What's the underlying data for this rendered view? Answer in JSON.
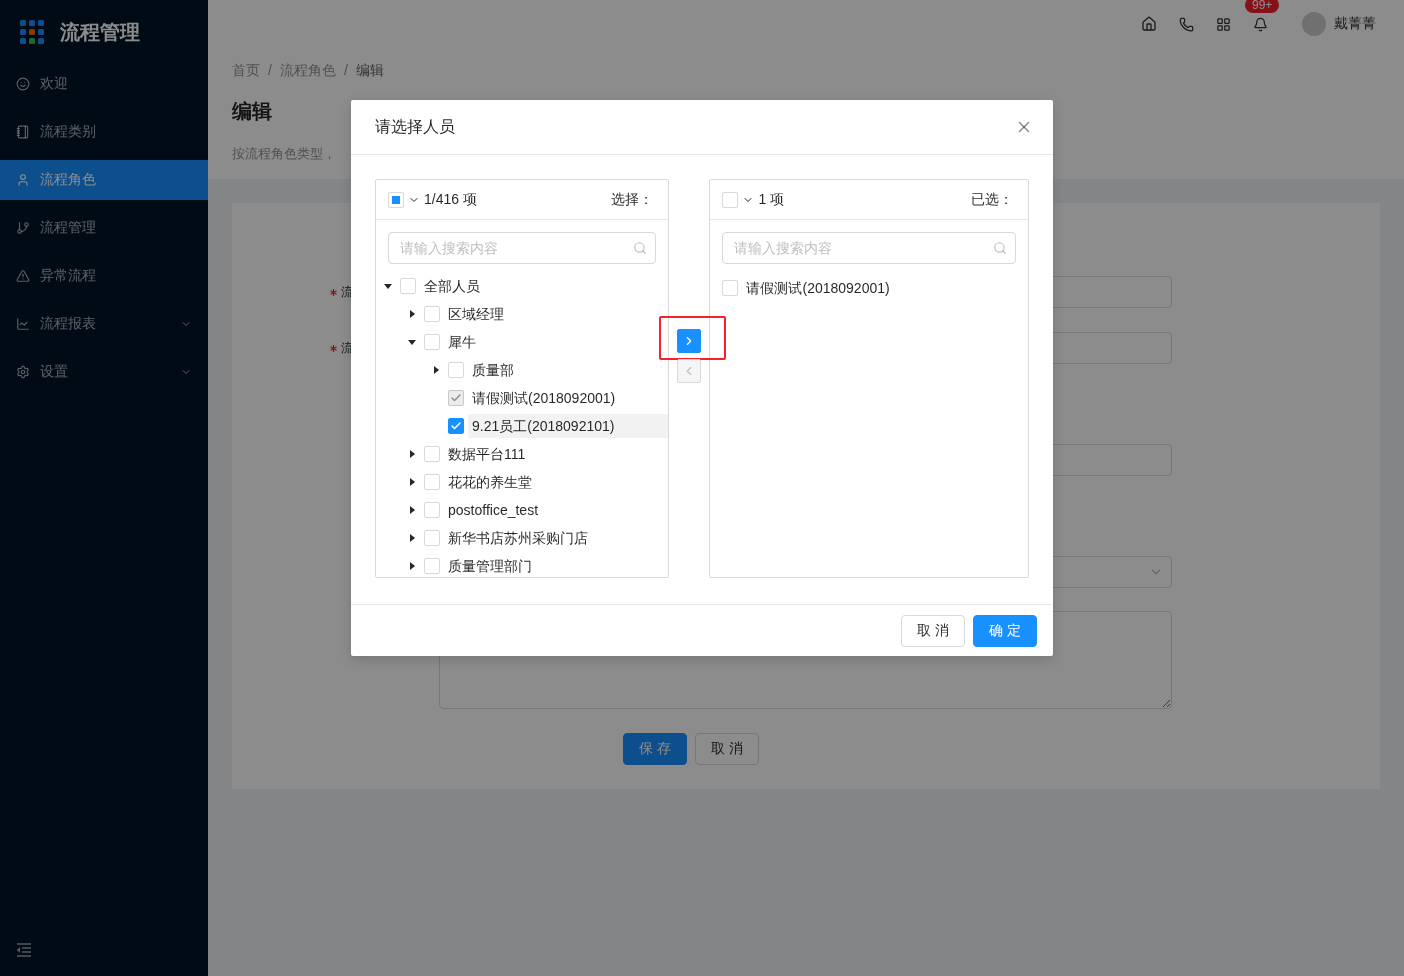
{
  "sidebar": {
    "logo_title": "流程管理",
    "items": [
      {
        "label": "欢迎",
        "selected": false,
        "expandable": false
      },
      {
        "label": "流程类别",
        "selected": false,
        "expandable": false
      },
      {
        "label": "流程角色",
        "selected": true,
        "expandable": false
      },
      {
        "label": "流程管理",
        "selected": false,
        "expandable": false
      },
      {
        "label": "异常流程",
        "selected": false,
        "expandable": false
      },
      {
        "label": "流程报表",
        "selected": false,
        "expandable": true
      },
      {
        "label": "设置",
        "selected": false,
        "expandable": true
      }
    ]
  },
  "header": {
    "notification_count": "99+",
    "user_name": "戴菁菁"
  },
  "page": {
    "breadcrumb": {
      "separator": "/",
      "items": [
        "首页",
        "流程角色",
        "编辑"
      ]
    },
    "title": "编辑",
    "description": "按流程角色类型，"
  },
  "form": {
    "fields": [
      {
        "kind": "input",
        "label": "流",
        "required": true
      },
      {
        "kind": "input",
        "label": "流",
        "required": true
      },
      {
        "kind": "input"
      },
      {
        "kind": "select"
      },
      {
        "kind": "textarea"
      }
    ],
    "buttons": [
      {
        "label": "保 存",
        "kind": "primary"
      },
      {
        "label": "取 消",
        "kind": "default"
      }
    ]
  },
  "modal": {
    "title": "请选择人员",
    "source": {
      "select_all_indeterminate": true,
      "count": "1/416 项",
      "title": "选择：",
      "search_placeholder": "请输入搜索内容",
      "tree": [
        {
          "label": "全部人员",
          "kind": "branch",
          "expanded": true,
          "checked": false,
          "selected": false,
          "children": [
            {
              "label": "区域经理",
              "kind": "branch",
              "expanded": false,
              "checked": false,
              "selected": false
            },
            {
              "label": "犀牛",
              "kind": "branch",
              "expanded": true,
              "checked": false,
              "selected": false,
              "children": [
                {
                  "label": "质量部",
                  "kind": "branch",
                  "expanded": false,
                  "checked": false,
                  "selected": false
                },
                {
                  "label": "请假测试(2018092001)",
                  "kind": "leaf",
                  "checked": true,
                  "disabled": true,
                  "selected": false
                },
                {
                  "label": "9.21员工(2018092101)",
                  "kind": "leaf",
                  "checked": true,
                  "disabled": false,
                  "selected": true
                }
              ]
            },
            {
              "label": "数据平台111",
              "kind": "branch",
              "expanded": false,
              "checked": false,
              "selected": false
            },
            {
              "label": "花花的养生堂",
              "kind": "branch",
              "expanded": false,
              "checked": false,
              "selected": false
            },
            {
              "label": "postoffice_test",
              "kind": "branch",
              "expanded": false,
              "checked": false,
              "selected": false
            },
            {
              "label": "新华书店苏州采购门店",
              "kind": "branch",
              "expanded": false,
              "checked": false,
              "selected": false
            },
            {
              "label": "质量管理部门",
              "kind": "branch",
              "expanded": false,
              "checked": false,
              "selected": false
            }
          ]
        }
      ]
    },
    "operations": [
      {
        "kind": "move_right",
        "disabled": false,
        "highlighted": true
      },
      {
        "kind": "move_left",
        "disabled": true
      }
    ],
    "target": {
      "select_all_checked": false,
      "select_all_indeterminate": false,
      "count": "1 项",
      "title": "已选：",
      "search_placeholder": "请输入搜索内容",
      "items": [
        {
          "label": "请假测试(2018092001)",
          "checked": false
        }
      ]
    },
    "buttons": [
      {
        "label": "取 消",
        "kind": "default"
      },
      {
        "label": "确 定",
        "kind": "primary"
      }
    ]
  }
}
